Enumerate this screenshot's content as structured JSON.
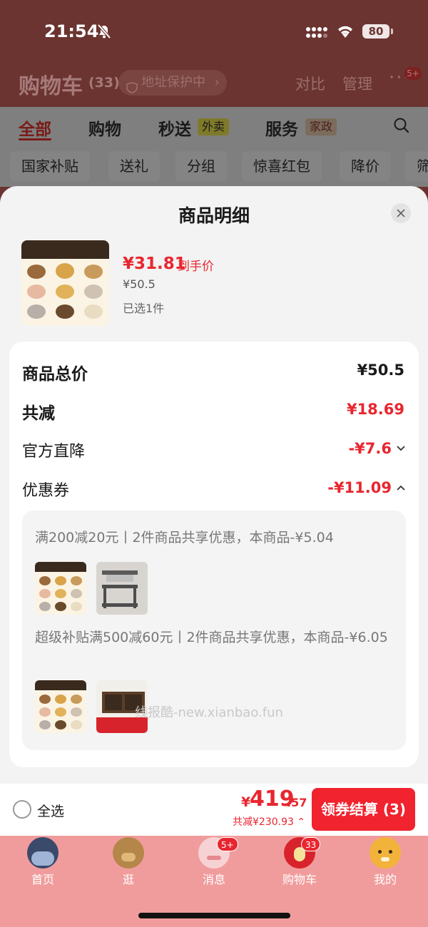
{
  "status_bar": {
    "time": "21:54",
    "battery": "80"
  },
  "header": {
    "title": "购物车",
    "count": "(33)",
    "address_badge": "地址保护中",
    "compare": "对比",
    "manage": "管理",
    "more_badge": "5+"
  },
  "tabs": [
    {
      "label": "全部"
    },
    {
      "label": "购物"
    },
    {
      "label": "秒送",
      "tag": "外卖"
    },
    {
      "label": "服务",
      "tag": "家政"
    }
  ],
  "filter_chips": [
    "国家补贴",
    "送礼",
    "分组",
    "惊喜红包",
    "降价",
    "筛"
  ],
  "sheet": {
    "title": "商品明细",
    "product": {
      "final_price": "¥31.81",
      "final_price_label": "到手价",
      "original_price": "¥50.5",
      "selected_count": "已选1件"
    },
    "rows": {
      "total_label": "商品总价",
      "total_value": "¥50.5",
      "reduce_label": "共减",
      "reduce_value": "¥18.69",
      "official_label": "官方直降",
      "official_value": "-¥7.6",
      "coupon_label": "优惠券",
      "coupon_value": "-¥11.09"
    },
    "coupons": [
      {
        "text": "满200减20元丨2件商品共享优惠，本商品-¥5.04"
      },
      {
        "text": "超级补贴满500减60元丨2件商品共享优惠，本商品-¥6.05"
      }
    ],
    "watermark": "线报酷-new.xianbao.fun"
  },
  "checkout": {
    "select_all": "全选",
    "currency": "¥",
    "total_int": "419",
    "total_dec": ".57",
    "saved": "共减¥230.93",
    "button": "领券结算 (3)"
  },
  "nav": [
    {
      "label": "首页"
    },
    {
      "label": "逛"
    },
    {
      "label": "消息",
      "badge": "5+"
    },
    {
      "label": "购物车",
      "badge": "33"
    },
    {
      "label": "我的"
    }
  ],
  "colors": {
    "accent": "#e8262f",
    "tabbar": "#f19c9c",
    "sheet_bg": "#f3f3f3"
  }
}
